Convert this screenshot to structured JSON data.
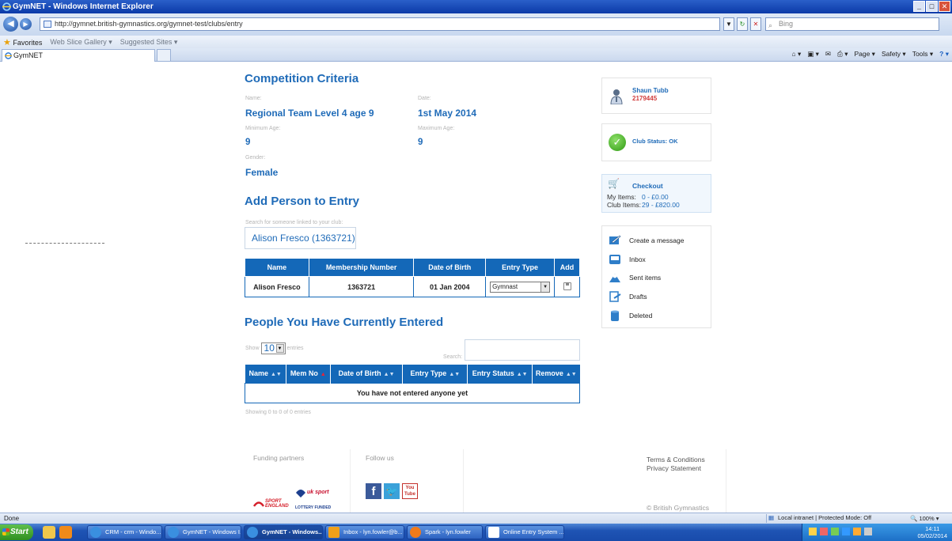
{
  "window": {
    "title": "GymNET - Windows Internet Explorer",
    "url": "http://gymnet.british-gymnastics.org/gymnet-test/clubs/entry",
    "search_placeholder": "Bing",
    "favorites": "Favorites",
    "web_slice": "Web Slice Gallery ▾",
    "suggested": "Suggested Sites ▾",
    "tab_title": "GymNET",
    "command_bar": {
      "page": "Page ▾",
      "safety": "Safety ▾",
      "tools": "Tools ▾"
    }
  },
  "criteria": {
    "heading": "Competition Criteria",
    "name_label": "Name:",
    "name_value": "Regional Team Level 4 age 9",
    "date_label": "Date:",
    "date_value": "1st May 2014",
    "min_age_label": "Minimum Age:",
    "min_age_value": "9",
    "max_age_label": "Maximum Age:",
    "max_age_value": "9",
    "gender_label": "Gender:",
    "gender_value": "Female"
  },
  "add_person": {
    "heading": "Add Person to Entry",
    "search_label": "Search for someone linked to your club:",
    "search_value": "Alison Fresco (1363721)",
    "columns": [
      "Name",
      "Membership Number",
      "Date of Birth",
      "Entry Type",
      "Add"
    ],
    "row": {
      "name": "Alison Fresco",
      "membership": "1363721",
      "dob": "01 Jan 2004",
      "entry_type": "Gymnast"
    }
  },
  "entered": {
    "heading": "People You Have Currently Entered",
    "show_label": "Show",
    "show_value": "10",
    "entries_label": "entries",
    "search_label": "Search:",
    "columns": [
      "Name",
      "Mem No",
      "Date of Birth",
      "Entry Type",
      "Entry Status",
      "Remove"
    ],
    "empty_text": "You have not entered anyone yet",
    "showing_text": "Showing 0 to 0 of 0 entries"
  },
  "sidebar": {
    "user_name": "Shaun Tubb",
    "user_id": "2179445",
    "club_status": "Club Status: OK",
    "checkout": {
      "title": "Checkout",
      "my_items_label": "My Items:",
      "my_items_value": "0 - £0.00",
      "club_items_label": "Club Items:",
      "club_items_value": "29 - £820.00"
    },
    "messages": [
      "Create a message",
      "Inbox",
      "Sent items",
      "Drafts",
      "Deleted"
    ]
  },
  "footer": {
    "funding": "Funding partners",
    "follow": "Follow us",
    "terms": "Terms & Conditions",
    "privacy": "Privacy Statement",
    "copyright": "© British Gymnastics",
    "sport_england": "SPORT ENGLAND",
    "uk_sport": "uk sport",
    "lottery": "LOTTERY FUNDED",
    "youtube": "You Tube"
  },
  "statusbar": {
    "left": "Done",
    "zone": "Local intranet | Protected Mode: Off",
    "zoom": "100%"
  },
  "taskbar": {
    "start": "Start",
    "tasks": [
      "CRM - crm - Windo...",
      "GymNET - Windows I...",
      "GymNET - Windows...",
      "Inbox - lyn.fowler@b...",
      "Spark - lyn.fowler",
      "Online Entry System ..."
    ],
    "time": "14:11",
    "date": "05/02/2014"
  },
  "colors": {
    "brand_blue": "#1f6bb8",
    "table_header": "#1468b8"
  }
}
